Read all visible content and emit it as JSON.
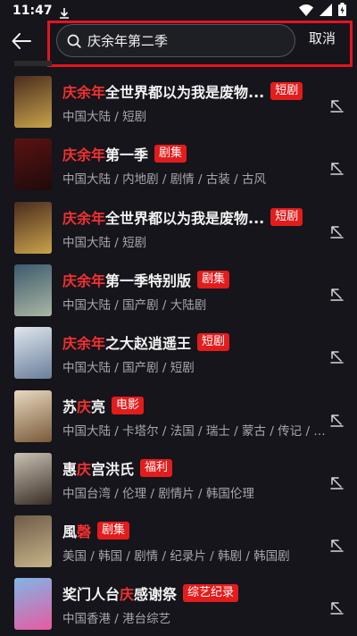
{
  "status_bar": {
    "time": "11:47"
  },
  "search": {
    "query": "庆余年第二季",
    "cancel_label": "取消"
  },
  "results": [
    {
      "title_parts": [
        {
          "text": "庆余年",
          "hl": true
        },
        {
          "text": "全世界都以为我是废物...",
          "hl": false
        }
      ],
      "tag": "短剧",
      "meta": "中国大陆 / 短剧",
      "poster_colors": [
        "#4a2c1e",
        "#c9a34c"
      ]
    },
    {
      "title_parts": [
        {
          "text": "庆余年",
          "hl": true
        },
        {
          "text": "第一季",
          "hl": false
        }
      ],
      "tag": "剧集",
      "meta": "中国大陆 / 内地剧 / 剧情 / 古装 / 古风",
      "poster_colors": [
        "#5a1212",
        "#1f0a0a"
      ]
    },
    {
      "title_parts": [
        {
          "text": "庆余年",
          "hl": true
        },
        {
          "text": "全世界都以为我是废物...",
          "hl": false
        }
      ],
      "tag": "短剧",
      "meta": "中国大陆 / 短剧",
      "poster_colors": [
        "#4a2c1e",
        "#c9a34c"
      ]
    },
    {
      "title_parts": [
        {
          "text": "庆余年",
          "hl": true
        },
        {
          "text": "第一季特别版",
          "hl": false
        }
      ],
      "tag": "剧集",
      "meta": "中国大陆 / 国产剧 / 大陆剧",
      "poster_colors": [
        "#3d5a6e",
        "#a9b7a2"
      ]
    },
    {
      "title_parts": [
        {
          "text": "庆余年",
          "hl": true
        },
        {
          "text": "之大赵逍遥王",
          "hl": false
        }
      ],
      "tag": "短剧",
      "meta": "中国大陆 / 国产剧 / 短剧",
      "poster_colors": [
        "#dfe6ee",
        "#6a7f9a"
      ]
    },
    {
      "title_parts": [
        {
          "text": "苏",
          "hl": false
        },
        {
          "text": "庆",
          "hl": true
        },
        {
          "text": "亮",
          "hl": false
        }
      ],
      "tag": "电影",
      "meta": "中国大陆 / 卡塔尔 / 法国 / 瑞士 / 蒙古 / 传记 / 剧情",
      "poster_colors": [
        "#e8d9c0",
        "#7a5a3a"
      ]
    },
    {
      "title_parts": [
        {
          "text": "惠",
          "hl": false
        },
        {
          "text": "庆",
          "hl": true
        },
        {
          "text": "宫洪氏",
          "hl": false
        }
      ],
      "tag": "福利",
      "meta": "中国台湾 / 伦理 / 剧情片 / 韩国伦理",
      "poster_colors": [
        "#c9c2b4",
        "#3a2e26"
      ]
    },
    {
      "title_parts": [
        {
          "text": "風",
          "hl": false
        },
        {
          "text": "磬",
          "hl": true
        }
      ],
      "tag": "剧集",
      "meta": "美国 / 韩国 / 剧情 / 纪录片 / 韩剧 / 韩国剧",
      "poster_colors": [
        "#6e5c48",
        "#c8b48a"
      ]
    },
    {
      "title_parts": [
        {
          "text": "奖门人台",
          "hl": false
        },
        {
          "text": "庆",
          "hl": true
        },
        {
          "text": "感谢祭",
          "hl": false
        }
      ],
      "tag": "综艺纪录",
      "meta": "中国香港 / 港台综艺",
      "poster_colors": [
        "#7fb6e8",
        "#e85aa0"
      ]
    }
  ]
}
